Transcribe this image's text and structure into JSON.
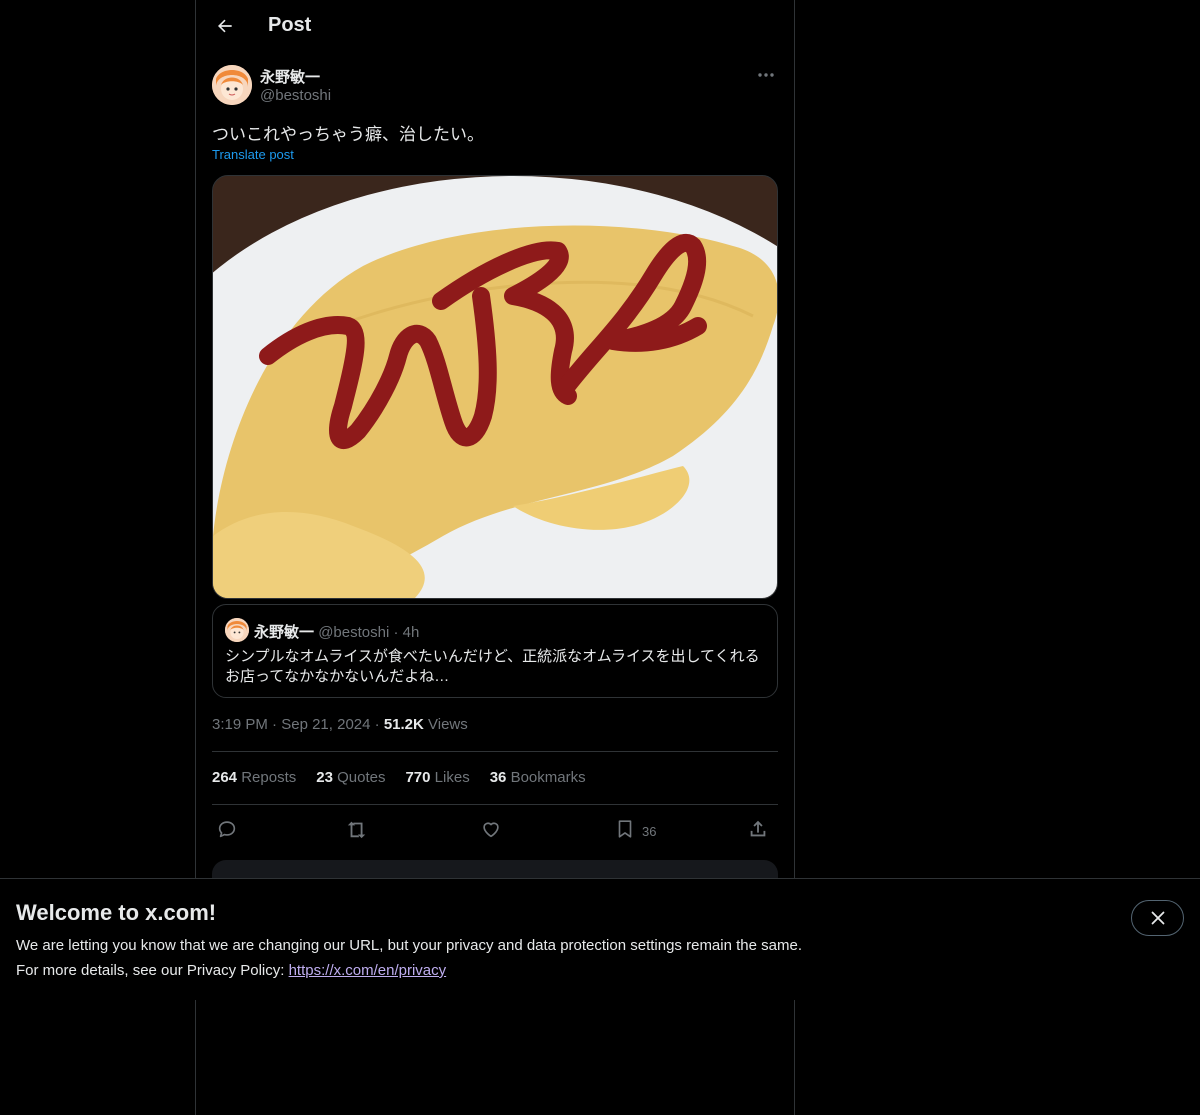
{
  "header": {
    "title": "Post"
  },
  "post": {
    "author_name": "永野敏一",
    "author_handle": "@bestoshi",
    "text": "ついこれやっちゃう癖、治したい。",
    "translate_label": "Translate post",
    "quote": {
      "author_name": "永野敏一",
      "author_handle": "@bestoshi",
      "separator": "·",
      "age": "4h",
      "text": "シンプルなオムライスが食べたいんだけど、正統派なオムライスを出してくれるお店ってなかなかないんだよね…"
    },
    "time": "3:19 PM",
    "date": "Sep 21, 2024",
    "dot": "·",
    "views_count": "51.2K",
    "views_label": "Views"
  },
  "stats": {
    "reposts_count": "264",
    "reposts_label": "Reposts",
    "quotes_count": "23",
    "quotes_label": "Quotes",
    "likes_count": "770",
    "likes_label": "Likes",
    "bookmarks_count": "36",
    "bookmarks_label": "Bookmarks"
  },
  "actions": {
    "bookmark_count": "36"
  },
  "banner": {
    "title": "Welcome to x.com!",
    "line1": "We are letting you know that we are changing our URL, but your privacy and data protection settings remain the same.",
    "line2_prefix": "For more details, see our Privacy Policy: ",
    "link": "https://x.com/en/privacy"
  },
  "colors": {
    "accent": "#1d9bf0",
    "muted": "#71767b",
    "ketchup": "#8e1a1a",
    "omelette": "#e9c66a"
  },
  "icons": [
    "back-arrow-icon",
    "more-icon",
    "reply-icon",
    "repost-icon",
    "like-icon",
    "bookmark-icon",
    "share-icon",
    "close-icon"
  ]
}
